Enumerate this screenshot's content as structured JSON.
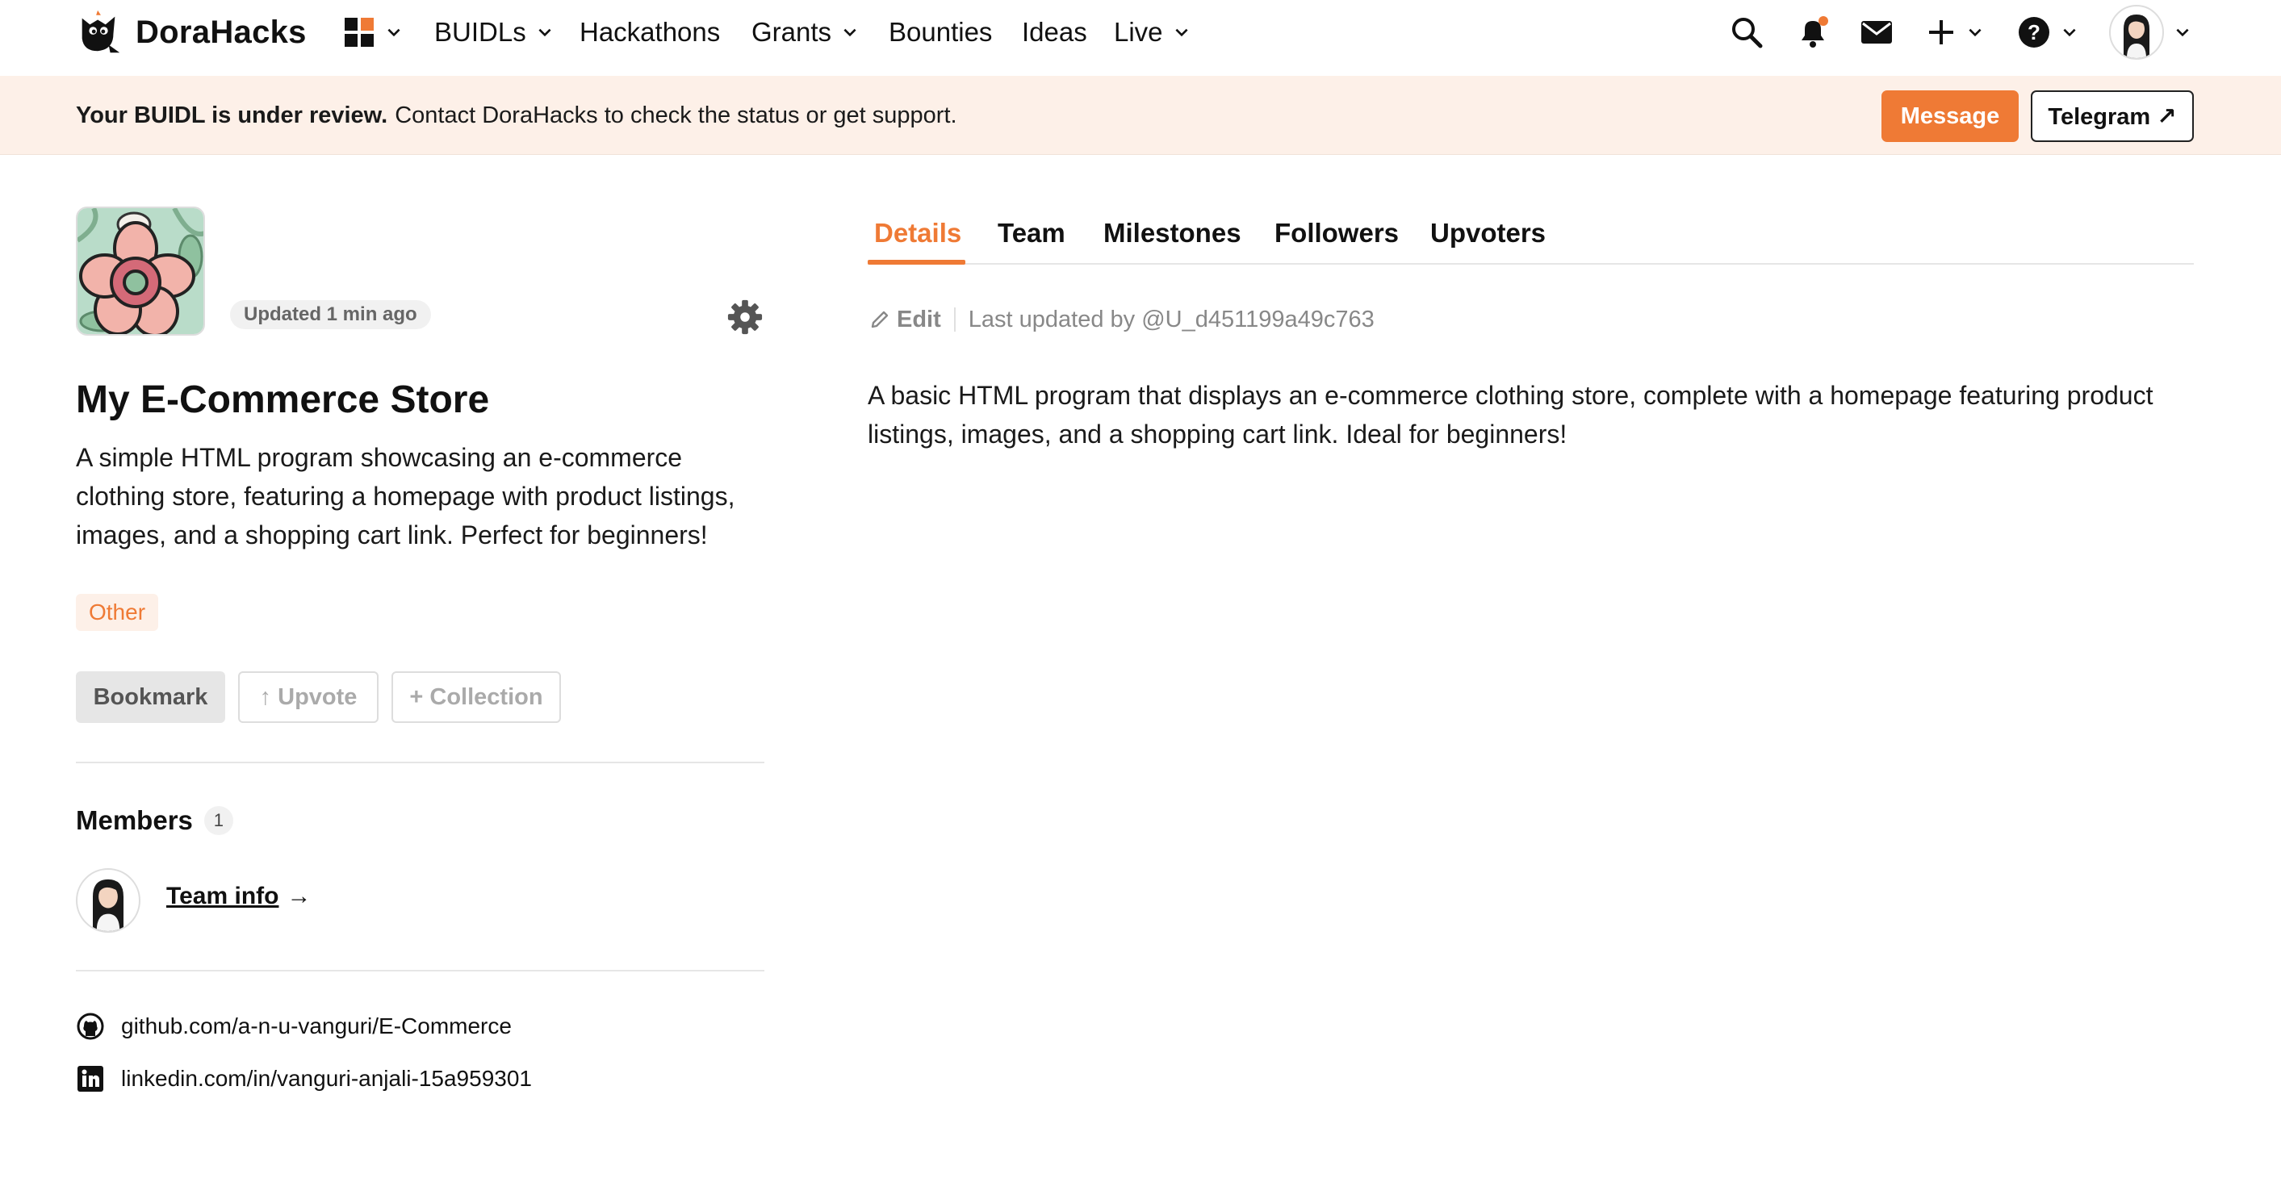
{
  "nav": {
    "brand": "DoraHacks",
    "items": [
      {
        "label": "BUIDLs",
        "dropdown": true
      },
      {
        "label": "Hackathons",
        "dropdown": false
      },
      {
        "label": "Grants",
        "dropdown": true
      },
      {
        "label": "Bounties",
        "dropdown": false
      },
      {
        "label": "Ideas",
        "dropdown": false
      },
      {
        "label": "Live",
        "dropdown": true
      }
    ],
    "right_icons": [
      "search-icon",
      "bell-icon",
      "mail-icon",
      "plus-icon",
      "help-icon",
      "avatar"
    ]
  },
  "banner": {
    "strong": "Your BUIDL is under review.",
    "text": "Contact DoraHacks to check the status or get support.",
    "message_label": "Message",
    "telegram_label": "Telegram ↗"
  },
  "project": {
    "updated": "Updated 1 min ago",
    "title": "My E-Commerce Store",
    "description": "A simple HTML program showcasing an e-commerce clothing store, featuring a homepage with product listings, images, and a shopping cart link. Perfect for beginners!",
    "tag": "Other",
    "bookmark_label": "Bookmark",
    "upvote_label": "↑ Upvote",
    "collection_label": "+ Collection"
  },
  "members": {
    "title": "Members",
    "count": "1",
    "team_info_label": "Team info",
    "team_info_arrow": "→"
  },
  "links": {
    "github": "github.com/a-n-u-vanguri/E-Commerce",
    "linkedin": "linkedin.com/in/vanguri-anjali-15a959301"
  },
  "tabs": [
    "Details",
    "Team",
    "Milestones",
    "Followers",
    "Upvoters"
  ],
  "details": {
    "edit_label": "Edit",
    "last_updated": "Last updated by @U_d451199a49c763",
    "text": "A basic HTML program that displays an e-commerce clothing store, complete with a homepage featuring product listings, images, and a shopping cart link. Ideal for beginners!"
  },
  "colors": {
    "accent": "#ef7a35",
    "banner_bg": "#fdf0e8"
  }
}
